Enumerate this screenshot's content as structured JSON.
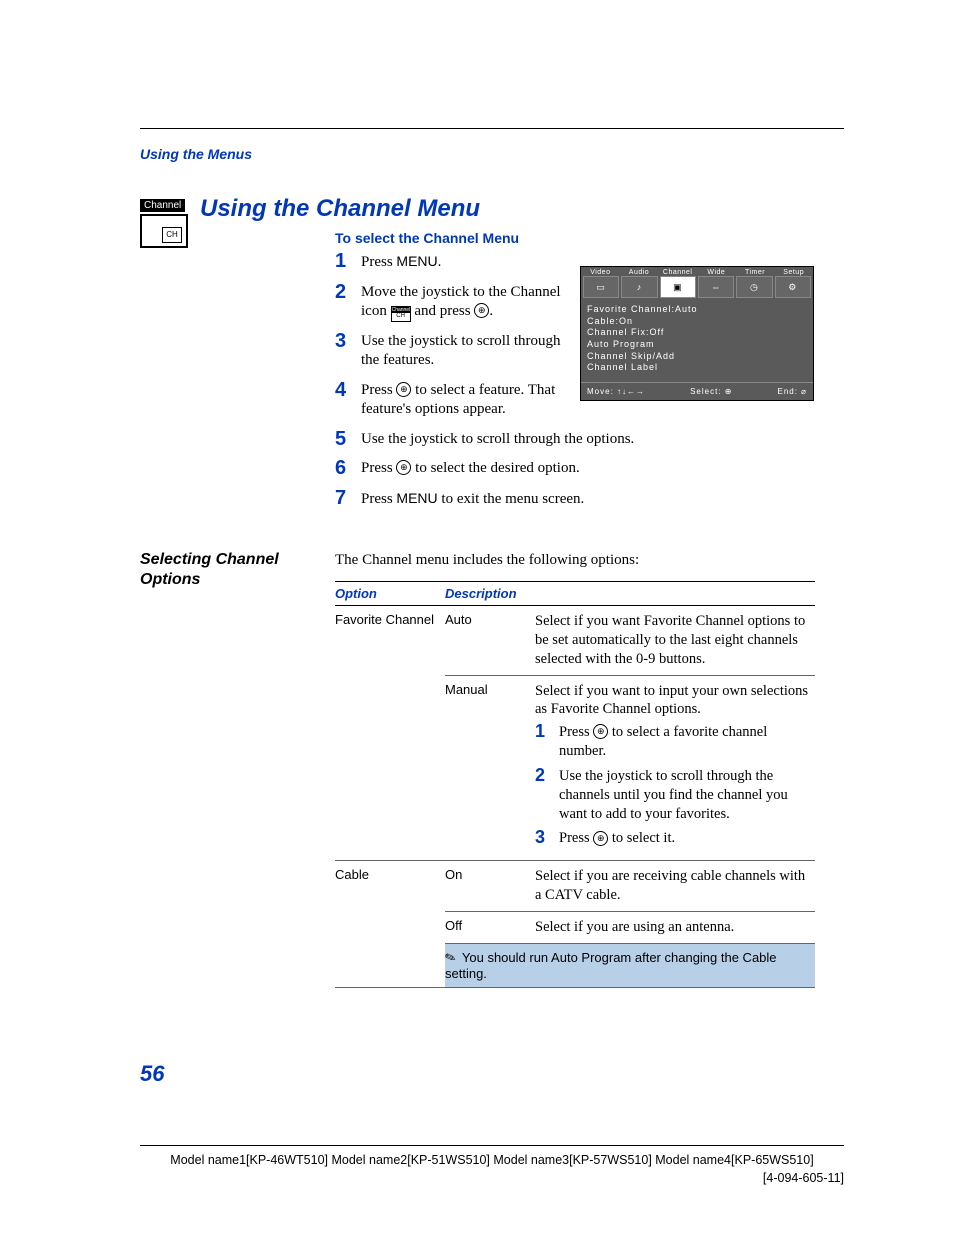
{
  "breadcrumb": "Using the Menus",
  "title": "Using the Channel Menu",
  "channel_badge": "Channel",
  "channel_icon_text": "CH",
  "subhead": "To select the Channel Menu",
  "steps": {
    "s1_a": "Press ",
    "s1_b": "MENU",
    "s1_c": ".",
    "s2_a": "Move the joystick to the Channel icon ",
    "s2_b": " and press ",
    "s2_c": ".",
    "s3": "Use the joystick to scroll through the features.",
    "s4_a": "Press ",
    "s4_b": " to select a feature. That feature's options appear.",
    "s5": "Use the joystick to scroll through the options.",
    "s6_a": "Press ",
    "s6_b": " to select the desired option.",
    "s7_a": "Press ",
    "s7_b": "MENU",
    "s7_c": " to exit the menu screen."
  },
  "tv_menu": {
    "tabs": [
      "Video",
      "Audio",
      "Channel",
      "Wide",
      "Timer",
      "Setup"
    ],
    "lines": [
      "Favorite Channel:Auto",
      "Cable:On",
      "Channel Fix:Off",
      "Auto Program",
      "Channel Skip/Add",
      "Channel Label"
    ],
    "footer_move": "Move: ↑↓←→",
    "footer_select": "Select: ⊕",
    "footer_end": "End: ⌀"
  },
  "sidehead": "Selecting Channel Options",
  "intro": "The Channel menu includes the following options:",
  "table": {
    "h1": "Option",
    "h2": "Description",
    "fav_label": "Favorite Channel",
    "fav_auto": "Auto",
    "fav_auto_desc": "Select if you want Favorite Channel options to be set automatically to the last eight channels selected with the 0-9 buttons.",
    "fav_manual": "Manual",
    "fav_manual_desc": "Select if you want to input your own selections as Favorite Channel options.",
    "fav_sub1_a": "Press ",
    "fav_sub1_b": " to select a favorite channel number.",
    "fav_sub2": "Use the joystick to scroll through the channels until you find the channel you want to add to your favorites.",
    "fav_sub3_a": "Press ",
    "fav_sub3_b": " to select it.",
    "cable_label": "Cable",
    "cable_on": "On",
    "cable_on_desc": "Select if you are receiving cable channels with a CATV cable.",
    "cable_off": "Off",
    "cable_off_desc": "Select if you are using an antenna.",
    "note": "You should run Auto Program after changing the Cable setting."
  },
  "page_number": "56",
  "footer_line1": "Model name1[KP-46WT510]  Model name2[KP-51WS510]  Model name3[KP-57WS510]  Model name4[KP-65WS510]",
  "footer_line2": "[4-094-605-11]",
  "icons": {
    "joystick": "⊕"
  }
}
